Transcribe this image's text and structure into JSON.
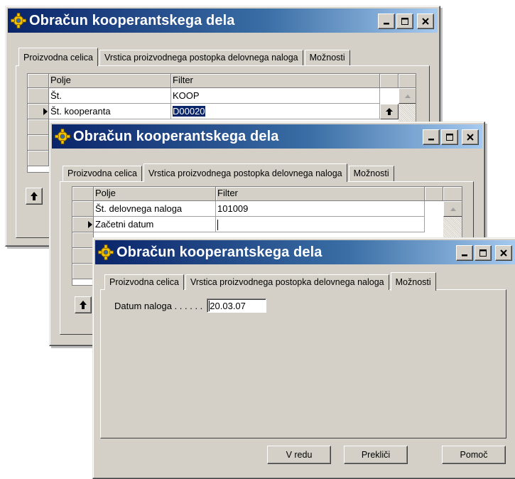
{
  "colors": {
    "title_start": "#0a246a",
    "title_end": "#a6caf0",
    "face": "#d4d0c8",
    "selection": "#0a246a"
  },
  "windows": [
    {
      "title": "Obračun kooperantskega dela",
      "tabs": [
        "Proizvodna celica",
        "Vrstica proizvodnega postopka delovnega naloga",
        "Možnosti"
      ],
      "active_tab": "Proizvodna celica",
      "grid": {
        "headers": [
          "Polje",
          "Filter"
        ],
        "rows": [
          {
            "field": "Št.",
            "filter": "KOOP"
          },
          {
            "field": "Št. kooperanta",
            "filter": "D00020"
          }
        ]
      }
    },
    {
      "title": "Obračun kooperantskega dela",
      "tabs": [
        "Proizvodna celica",
        "Vrstica proizvodnega postopka delovnega naloga",
        "Možnosti"
      ],
      "active_tab": "Vrstica proizvodnega postopka delovnega naloga",
      "grid": {
        "headers": [
          "Polje",
          "Filter"
        ],
        "rows": [
          {
            "field": "Št. delovnega naloga",
            "filter": "101009"
          },
          {
            "field": "Začetni datum",
            "filter": ""
          }
        ]
      }
    },
    {
      "title": "Obračun kooperantskega dela",
      "tabs": [
        "Proizvodna celica",
        "Vrstica proizvodnega postopka delovnega naloga",
        "Možnosti"
      ],
      "active_tab": "Možnosti",
      "options": {
        "label": "Datum naloga . . . . . .",
        "value": "20.03.07"
      },
      "buttons": {
        "ok": "V redu",
        "cancel": "Prekliči",
        "help": "Pomoč"
      }
    }
  ]
}
